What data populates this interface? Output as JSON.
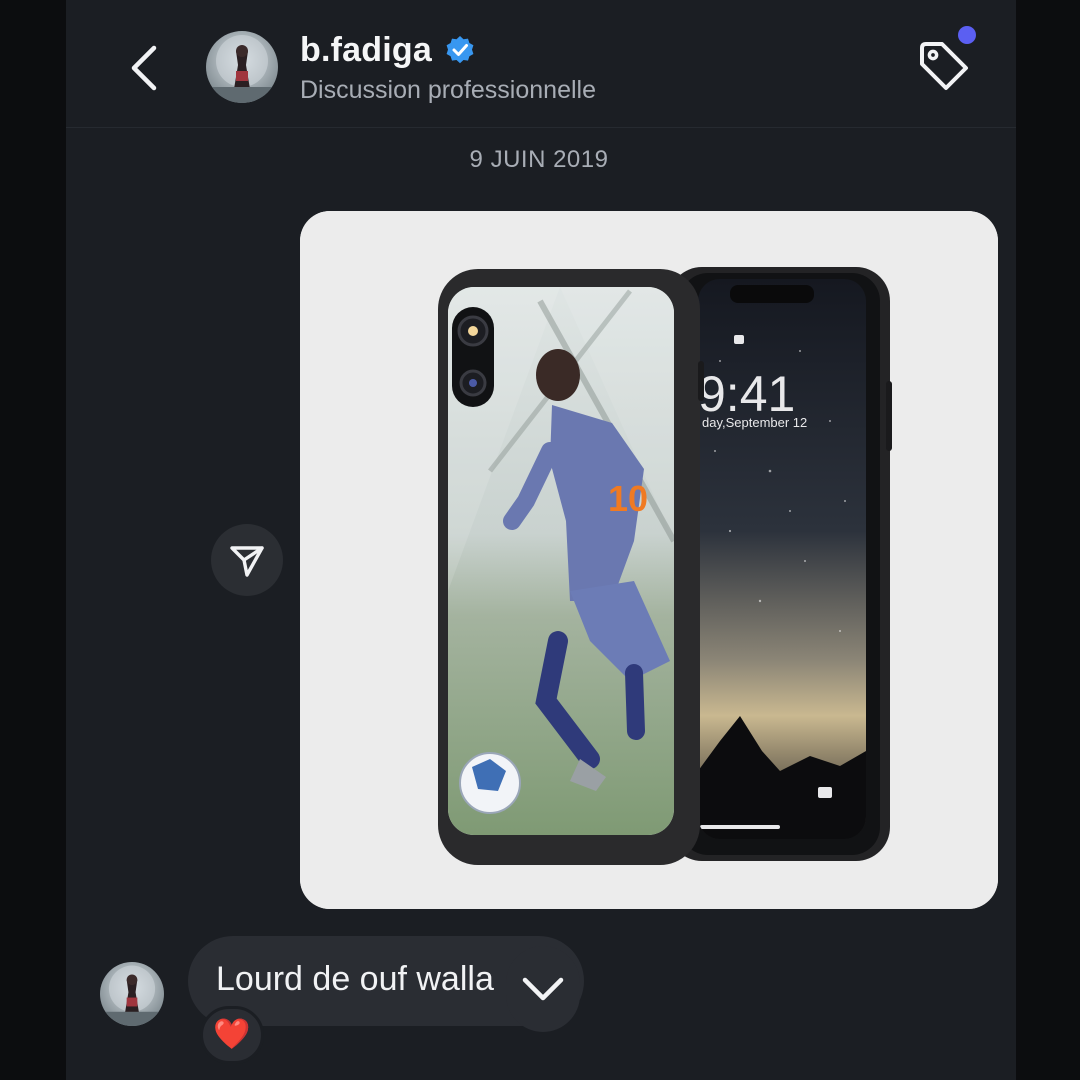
{
  "header": {
    "username": "b.fadiga",
    "subtitle": "Discussion professionnelle",
    "verified": true
  },
  "thread": {
    "date": "9 JUIN 2019",
    "messages": [
      {
        "type": "image",
        "from": "me",
        "description": "phone case photo"
      },
      {
        "type": "text",
        "from": "b.fadiga",
        "text": "Lourd de ouf walla",
        "reaction": "❤️"
      }
    ]
  },
  "colors": {
    "background": "#1b1e23",
    "bubble": "#2a2d33",
    "verified_blue": "#3897f0",
    "notification_dot": "#5b5ff2",
    "reaction_heart": "#e0242f"
  },
  "icons": [
    "back-chevron-icon",
    "verified-badge-icon",
    "tag-icon",
    "share-send-icon",
    "chevron-down-icon",
    "heart-icon"
  ]
}
